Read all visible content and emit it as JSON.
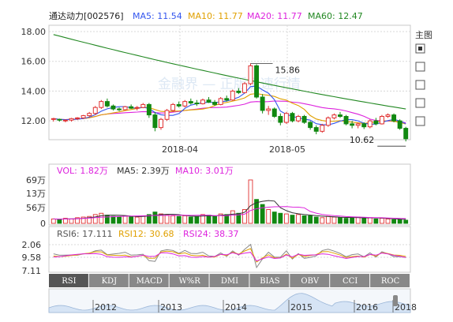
{
  "header": {
    "stock": "通达动力[002576]",
    "ma5": "MA5: 11.54",
    "ma10": "MA10: 11.77",
    "ma20": "MA20: 11.77",
    "ma60": "MA60: 12.47"
  },
  "colors": {
    "up": "#e03030",
    "down": "#118811",
    "ma5": "#3355ee",
    "ma10": "#e0a000",
    "ma20": "#dd22dd",
    "ma60": "#228822",
    "grid": "#d8d8d8",
    "tab_bg": "#888888",
    "tab_active": "#555555",
    "nav_fill": "#d6e4f5"
  },
  "watermark": "金融界 — 正版极速行情",
  "right_panel": {
    "title": "主图",
    "checkboxes": [
      {
        "checked": true
      },
      {
        "checked": false
      },
      {
        "checked": false
      },
      {
        "checked": false
      },
      {
        "checked": false
      }
    ]
  },
  "price_panel": {
    "y_ticks": [
      "18.00",
      "16.00",
      "14.00",
      "12.00"
    ],
    "x_ticks": [
      "2018-04",
      "2018-05"
    ],
    "max_label": "15.86",
    "min_label": "10.62"
  },
  "volume_panel": {
    "vol": "VOL: 1.82万",
    "ma5": "MA5: 2.39万",
    "ma10": "MA10: 3.01万",
    "y_ticks": [
      "69万",
      "13万",
      "56万",
      "0"
    ]
  },
  "rsi_panel": {
    "rsi6": "RSI6: 17.111",
    "rsi12": "RSI12: 30.68",
    "rsi24": "RSI24: 38.37",
    "y_ticks": [
      "2.06",
      "9.58",
      "7.11"
    ]
  },
  "tabs": [
    "RSI",
    "KDJ",
    "MACD",
    "W%R",
    "DMI",
    "BIAS",
    "OBV",
    "CCI",
    "ROC"
  ],
  "navigator": {
    "years": [
      "2012",
      "2013",
      "2014",
      "2015",
      "2016",
      "2018"
    ]
  },
  "chart_data": {
    "type": "candlestick",
    "title": "通达动力[002576]",
    "y_range": [
      10.5,
      18.0
    ],
    "x_labels": [
      "2018-04",
      "2018-05"
    ],
    "candles": [
      [
        12.1,
        12.2,
        11.95,
        12.15
      ],
      [
        12.1,
        12.15,
        11.95,
        12.05
      ],
      [
        12.0,
        12.1,
        11.9,
        12.05
      ],
      [
        12.05,
        12.2,
        11.95,
        12.15
      ],
      [
        12.15,
        12.25,
        12.05,
        12.2
      ],
      [
        12.2,
        12.4,
        12.15,
        12.35
      ],
      [
        12.35,
        12.6,
        12.25,
        12.5
      ],
      [
        12.5,
        13.0,
        12.4,
        12.9
      ],
      [
        12.9,
        13.4,
        12.8,
        13.3
      ],
      [
        13.3,
        13.5,
        12.9,
        13.0
      ],
      [
        13.0,
        13.1,
        12.7,
        12.8
      ],
      [
        12.8,
        12.9,
        12.65,
        12.75
      ],
      [
        12.75,
        13.0,
        12.7,
        12.95
      ],
      [
        12.95,
        13.1,
        12.8,
        12.85
      ],
      [
        12.85,
        13.0,
        12.7,
        12.9
      ],
      [
        12.9,
        13.2,
        12.85,
        13.1
      ],
      [
        13.1,
        13.2,
        12.2,
        12.4
      ],
      [
        12.4,
        12.6,
        11.3,
        11.55
      ],
      [
        11.55,
        12.2,
        11.4,
        12.1
      ],
      [
        12.1,
        12.8,
        12.0,
        12.7
      ],
      [
        12.7,
        13.2,
        12.6,
        13.1
      ],
      [
        13.1,
        13.3,
        12.9,
        13.0
      ],
      [
        13.0,
        13.4,
        12.9,
        13.3
      ],
      [
        13.3,
        13.5,
        13.1,
        13.2
      ],
      [
        13.2,
        13.4,
        13.0,
        13.15
      ],
      [
        13.15,
        13.5,
        13.1,
        13.4
      ],
      [
        13.4,
        13.6,
        13.2,
        13.25
      ],
      [
        13.25,
        13.4,
        13.0,
        13.1
      ],
      [
        13.1,
        13.6,
        13.05,
        13.5
      ],
      [
        13.5,
        13.7,
        13.3,
        13.4
      ],
      [
        13.4,
        14.1,
        13.35,
        14.0
      ],
      [
        14.0,
        14.2,
        13.8,
        13.9
      ],
      [
        13.9,
        14.6,
        13.85,
        14.5
      ],
      [
        14.5,
        15.86,
        14.4,
        15.7
      ],
      [
        15.7,
        15.8,
        13.5,
        13.6
      ],
      [
        13.6,
        13.8,
        12.5,
        12.7
      ],
      [
        12.7,
        13.0,
        12.4,
        12.8
      ],
      [
        12.8,
        12.9,
        12.2,
        12.3
      ],
      [
        12.3,
        12.5,
        11.7,
        11.9
      ],
      [
        11.9,
        12.6,
        11.8,
        12.5
      ],
      [
        12.5,
        12.6,
        11.9,
        12.0
      ],
      [
        12.0,
        12.4,
        11.9,
        12.3
      ],
      [
        12.3,
        12.4,
        11.8,
        11.9
      ],
      [
        11.9,
        12.0,
        11.4,
        11.55
      ],
      [
        11.55,
        11.7,
        11.1,
        11.3
      ],
      [
        11.3,
        11.8,
        11.2,
        11.7
      ],
      [
        11.7,
        12.3,
        11.6,
        12.2
      ],
      [
        12.2,
        12.5,
        12.1,
        12.4
      ],
      [
        12.4,
        12.6,
        12.2,
        12.3
      ],
      [
        12.3,
        12.4,
        11.7,
        11.8
      ],
      [
        11.8,
        12.0,
        11.5,
        11.7
      ],
      [
        11.7,
        11.9,
        11.5,
        11.8
      ],
      [
        11.8,
        11.9,
        11.45,
        11.6
      ],
      [
        11.6,
        12.1,
        11.5,
        12.0
      ],
      [
        12.0,
        12.2,
        11.7,
        11.8
      ],
      [
        11.8,
        12.4,
        11.75,
        12.3
      ],
      [
        12.3,
        12.5,
        12.2,
        12.4
      ],
      [
        12.4,
        12.5,
        11.9,
        12.0
      ],
      [
        12.0,
        12.1,
        11.4,
        11.5
      ],
      [
        11.5,
        11.6,
        10.62,
        10.8
      ]
    ],
    "volume": [
      7,
      6,
      8,
      7,
      9,
      10,
      11,
      14,
      16,
      13,
      11,
      10,
      12,
      11,
      10,
      12,
      14,
      18,
      15,
      13,
      12,
      11,
      12,
      10,
      11,
      14,
      13,
      11,
      15,
      14,
      20,
      16,
      22,
      69,
      38,
      30,
      22,
      18,
      16,
      15,
      13,
      14,
      12,
      12,
      10,
      9,
      11,
      10,
      9,
      8,
      9,
      10,
      8,
      9,
      7,
      8,
      7,
      6,
      6,
      5
    ]
  }
}
